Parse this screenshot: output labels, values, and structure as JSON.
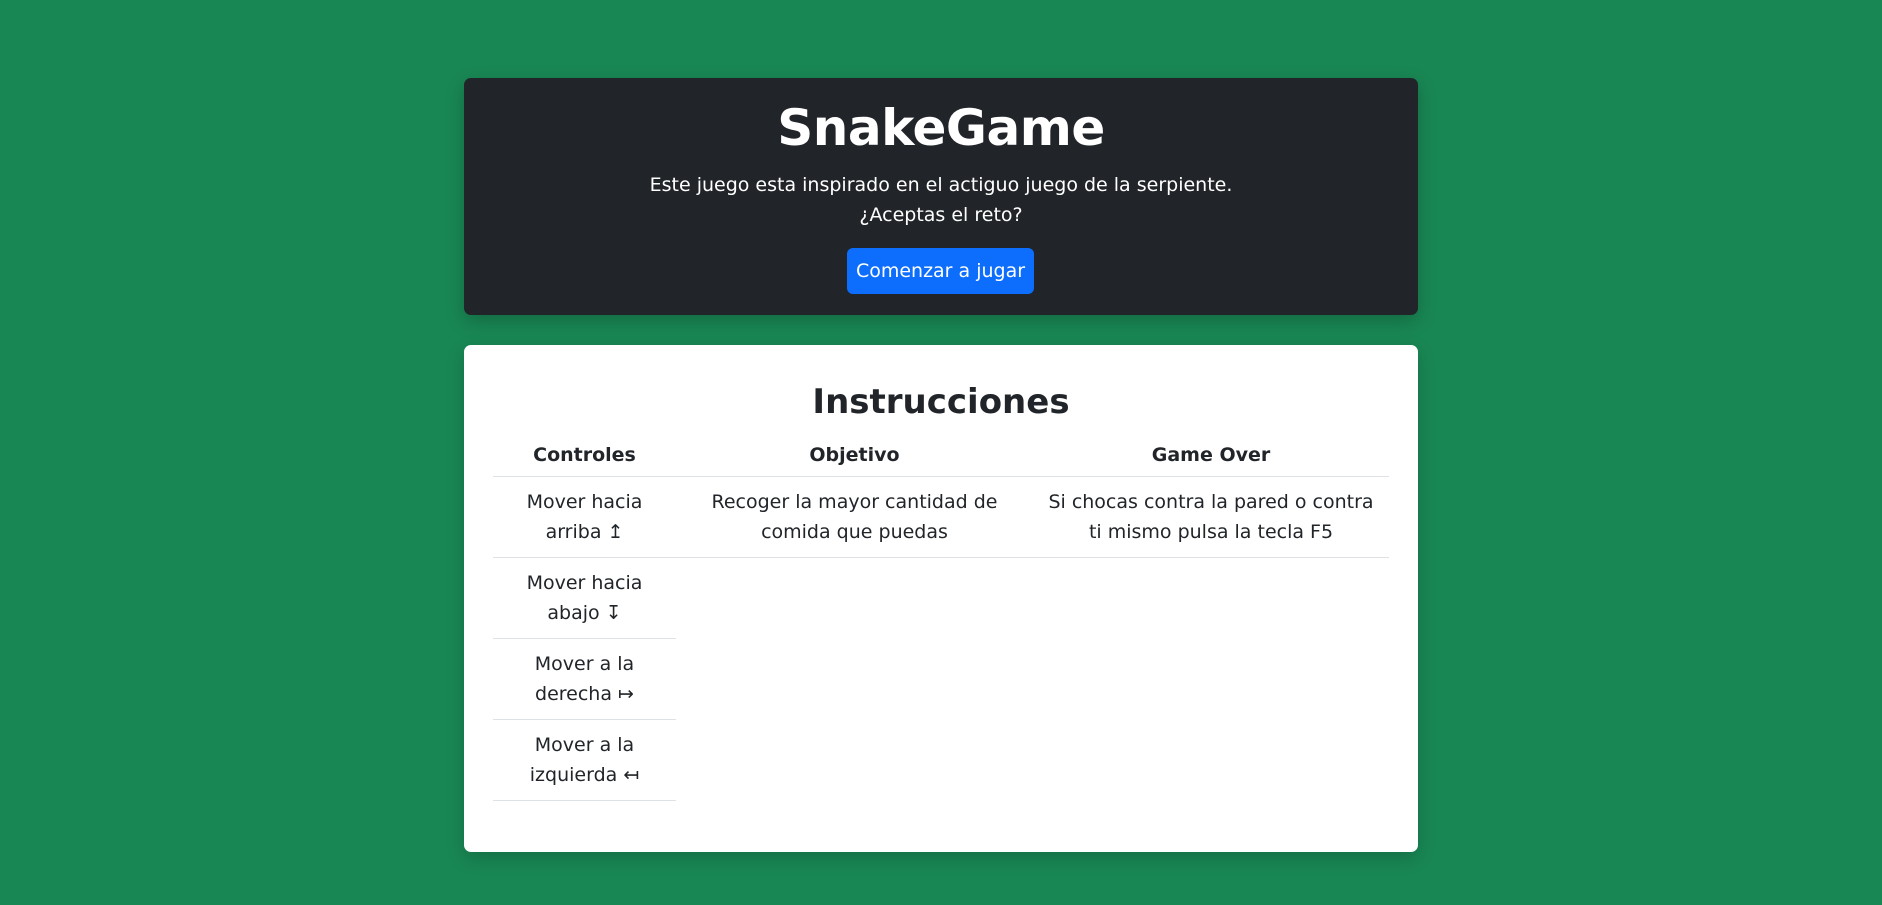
{
  "hero": {
    "title": "SnakeGame",
    "line1": "Este juego esta inspirado en el actiguo juego de la serpiente.",
    "line2": "¿Aceptas el reto?",
    "button": "Comenzar a jugar"
  },
  "instructions": {
    "title": "Instrucciones",
    "headers": [
      "Controles",
      "Objetivo",
      "Game Over"
    ],
    "controles": [
      "Mover hacia arriba ↥",
      "Mover hacia abajo ↧",
      "Mover a la derecha ↦",
      "Mover a la izquierda ↤"
    ],
    "objetivo": "Recoger la mayor cantidad de comida que puedas",
    "game_over": "Si chocas contra la pared o contra ti mismo pulsa la tecla F5"
  },
  "colors": {
    "background": "#198754",
    "hero_background": "#212529",
    "button": "#0d6efd"
  }
}
